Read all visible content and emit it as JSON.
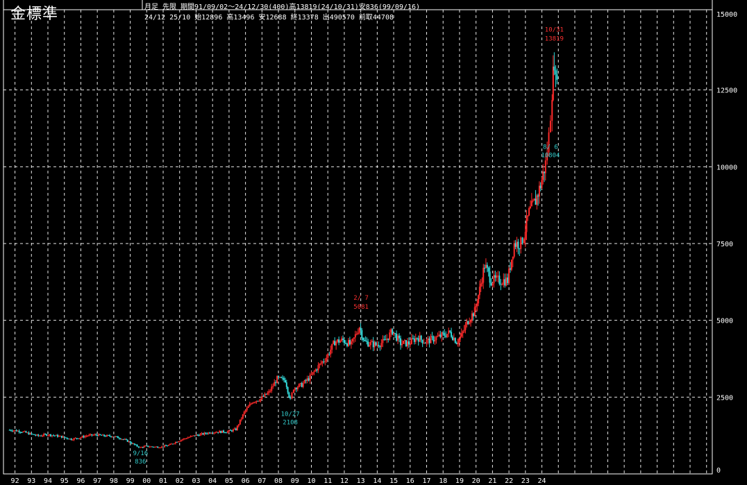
{
  "header": {
    "title": "金標準",
    "line1": "月足  先限  期間91/09/02～24/12/30(400)高13819(24/10/31)安836(99/09/16)",
    "line2": "24/12 25/10 始12896 高13496 安12688 終13378 出490570 前取44708"
  },
  "colors": {
    "background": "#000000",
    "grid": "#ffffff",
    "up": "#ff2a2a",
    "down": "#33dddd",
    "annotation_high": "#ff3030",
    "annotation_low": "#33cccc",
    "axis_text": "#ffffff"
  },
  "chart_data": {
    "type": "candlestick",
    "x_tick_labels": [
      "92",
      "93",
      "94",
      "95",
      "96",
      "97",
      "98",
      "99",
      "00",
      "01",
      "02",
      "03",
      "04",
      "05",
      "06",
      "07",
      "08",
      "09",
      "10",
      "11",
      "12",
      "13",
      "14",
      "15",
      "16",
      "17",
      "18",
      "19",
      "20",
      "21",
      "22",
      "23",
      "24"
    ],
    "y_tick_labels": [
      "0",
      "2500",
      "5000",
      "7500",
      "10000",
      "12500",
      "15000"
    ],
    "ylim": [
      0,
      15000
    ],
    "grid": true,
    "approximate_monthly_close": [
      [
        1991.75,
        1430
      ],
      [
        1992.0,
        1420
      ],
      [
        1992.5,
        1380
      ],
      [
        1993.0,
        1300
      ],
      [
        1993.5,
        1240
      ],
      [
        1994.0,
        1280
      ],
      [
        1994.5,
        1250
      ],
      [
        1995.0,
        1200
      ],
      [
        1995.5,
        1130
      ],
      [
        1996.0,
        1180
      ],
      [
        1996.5,
        1250
      ],
      [
        1997.0,
        1270
      ],
      [
        1997.5,
        1240
      ],
      [
        1998.0,
        1230
      ],
      [
        1998.5,
        1160
      ],
      [
        1999.0,
        1050
      ],
      [
        1999.5,
        900
      ],
      [
        1999.7,
        860
      ],
      [
        2000.0,
        900
      ],
      [
        2000.5,
        880
      ],
      [
        2001.0,
        880
      ],
      [
        2001.5,
        950
      ],
      [
        2002.0,
        1080
      ],
      [
        2002.5,
        1170
      ],
      [
        2003.0,
        1250
      ],
      [
        2003.5,
        1300
      ],
      [
        2004.0,
        1360
      ],
      [
        2004.5,
        1370
      ],
      [
        2005.0,
        1380
      ],
      [
        2005.5,
        1450
      ],
      [
        2006.0,
        2000
      ],
      [
        2006.5,
        2350
      ],
      [
        2007.0,
        2450
      ],
      [
        2007.5,
        2650
      ],
      [
        2008.0,
        3100
      ],
      [
        2008.5,
        3050
      ],
      [
        2008.8,
        2400
      ],
      [
        2009.0,
        2800
      ],
      [
        2009.5,
        2900
      ],
      [
        2010.0,
        3150
      ],
      [
        2010.5,
        3500
      ],
      [
        2011.0,
        3800
      ],
      [
        2011.5,
        4300
      ],
      [
        2012.0,
        4350
      ],
      [
        2012.5,
        4200
      ],
      [
        2013.0,
        4800
      ],
      [
        2013.3,
        4300
      ],
      [
        2013.6,
        4250
      ],
      [
        2014.0,
        4200
      ],
      [
        2014.5,
        4300
      ],
      [
        2015.0,
        4650
      ],
      [
        2015.5,
        4250
      ],
      [
        2016.0,
        4250
      ],
      [
        2016.5,
        4450
      ],
      [
        2017.0,
        4300
      ],
      [
        2017.5,
        4400
      ],
      [
        2018.0,
        4500
      ],
      [
        2018.5,
        4600
      ],
      [
        2018.9,
        4300
      ],
      [
        2019.2,
        4500
      ],
      [
        2019.6,
        5000
      ],
      [
        2020.0,
        5300
      ],
      [
        2020.3,
        6000
      ],
      [
        2020.6,
        6800
      ],
      [
        2021.0,
        6300
      ],
      [
        2021.5,
        6300
      ],
      [
        2022.0,
        6300
      ],
      [
        2022.4,
        7500
      ],
      [
        2022.8,
        7500
      ],
      [
        2023.0,
        7800
      ],
      [
        2023.3,
        8500
      ],
      [
        2023.7,
        8900
      ],
      [
        2024.0,
        9400
      ],
      [
        2024.3,
        10100
      ],
      [
        2024.5,
        11000
      ],
      [
        2024.7,
        12500
      ],
      [
        2024.83,
        13500
      ],
      [
        2024.92,
        12700
      ],
      [
        2025.0,
        13200
      ]
    ],
    "annotations": [
      {
        "date": "10/31",
        "value": "13819",
        "kind": "high",
        "x": 2024.83,
        "y": 13819
      },
      {
        "date": "8/ 6",
        "value": "10804",
        "kind": "low",
        "x": 2024.6,
        "y": 10804
      },
      {
        "date": "2/ 7",
        "value": "5081",
        "kind": "high",
        "x": 2013.1,
        "y": 5081
      },
      {
        "date": "10/27",
        "value": "2108",
        "kind": "low",
        "x": 2008.8,
        "y": 2108
      },
      {
        "date": "9/16",
        "value": "836",
        "kind": "low",
        "x": 1999.7,
        "y": 836
      }
    ]
  }
}
